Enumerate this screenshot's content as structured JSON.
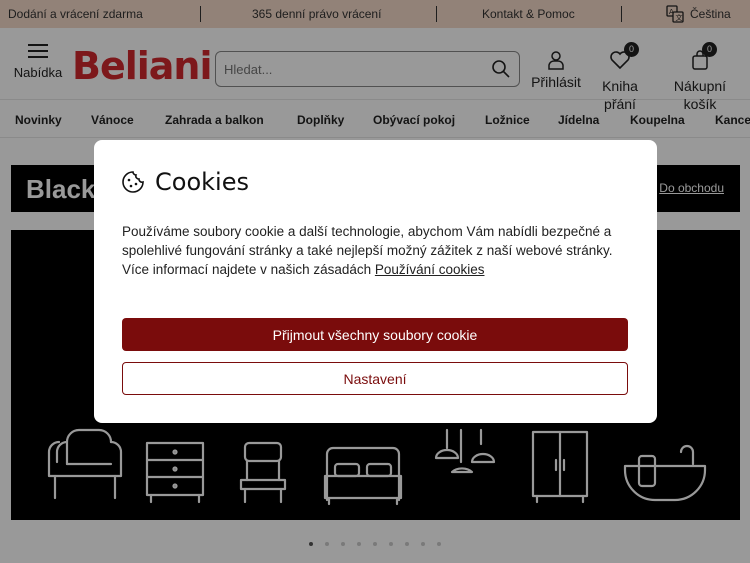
{
  "topbar": {
    "delivery": "Dodání a vrácení zdarma",
    "returns": "365 denní právo vrácení",
    "contact": "Kontakt & Pomoc",
    "language": "Čeština"
  },
  "header": {
    "menu_label": "Nabídka",
    "logo": "Beliani",
    "search_placeholder": "Hledat...",
    "login_label": "Přihlásit",
    "wishlist_label": "Kniha přání",
    "wishlist_count": "0",
    "cart_label": "Nákupní košík",
    "cart_count": "0"
  },
  "nav": {
    "items": [
      "Novinky",
      "Vánoce",
      "Zahrada a balkon",
      "Doplňky",
      "Obývací pokoj",
      "Ložnice",
      "Jídelna",
      "Koupelna",
      "Kance"
    ]
  },
  "banner": {
    "title": "Black",
    "link": "Do obchodu"
  },
  "carousel": {
    "active_index": 0,
    "count": 9
  },
  "cookies": {
    "title": "Cookies",
    "text": "Používáme soubory cookie a další technologie, abychom Vám nabídli bezpečné a spolehlivé fungování stránky a také nejlepší možný zážitek z naší webové stránky.",
    "more_text": "Více informací najdete v našich zásadách",
    "policy_link": "Používání cookies",
    "accept_label": "Přijmout všechny soubory cookie",
    "settings_label": "Nastavení"
  },
  "colors": {
    "brand": "#d0282e",
    "accent": "#7a0c0c",
    "topbar_bg": "#f4d9c8"
  }
}
